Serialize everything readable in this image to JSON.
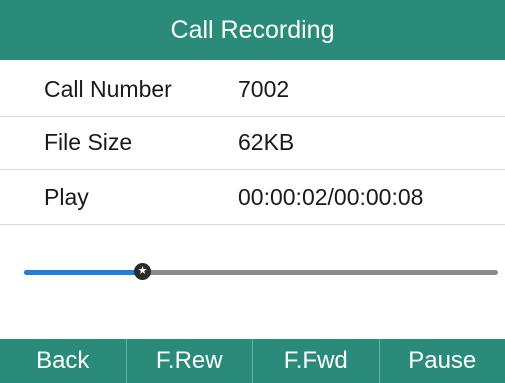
{
  "title": "Call Recording",
  "fields": [
    {
      "label": "Call Number",
      "value": "7002"
    },
    {
      "label": "File Size",
      "value": "62KB"
    },
    {
      "label": "Play",
      "value": "00:00:02/00:00:08"
    }
  ],
  "playback": {
    "elapsed_seconds": 2,
    "total_seconds": 8,
    "progress_fraction": 0.25
  },
  "softkeys": [
    "Back",
    "F.Rew",
    "F.Fwd",
    "Pause"
  ],
  "colors": {
    "accent": "#2a8b7a",
    "progress": "#1e7fd6",
    "track": "#8a8a8a"
  },
  "icons": {
    "knob": "star-icon"
  }
}
